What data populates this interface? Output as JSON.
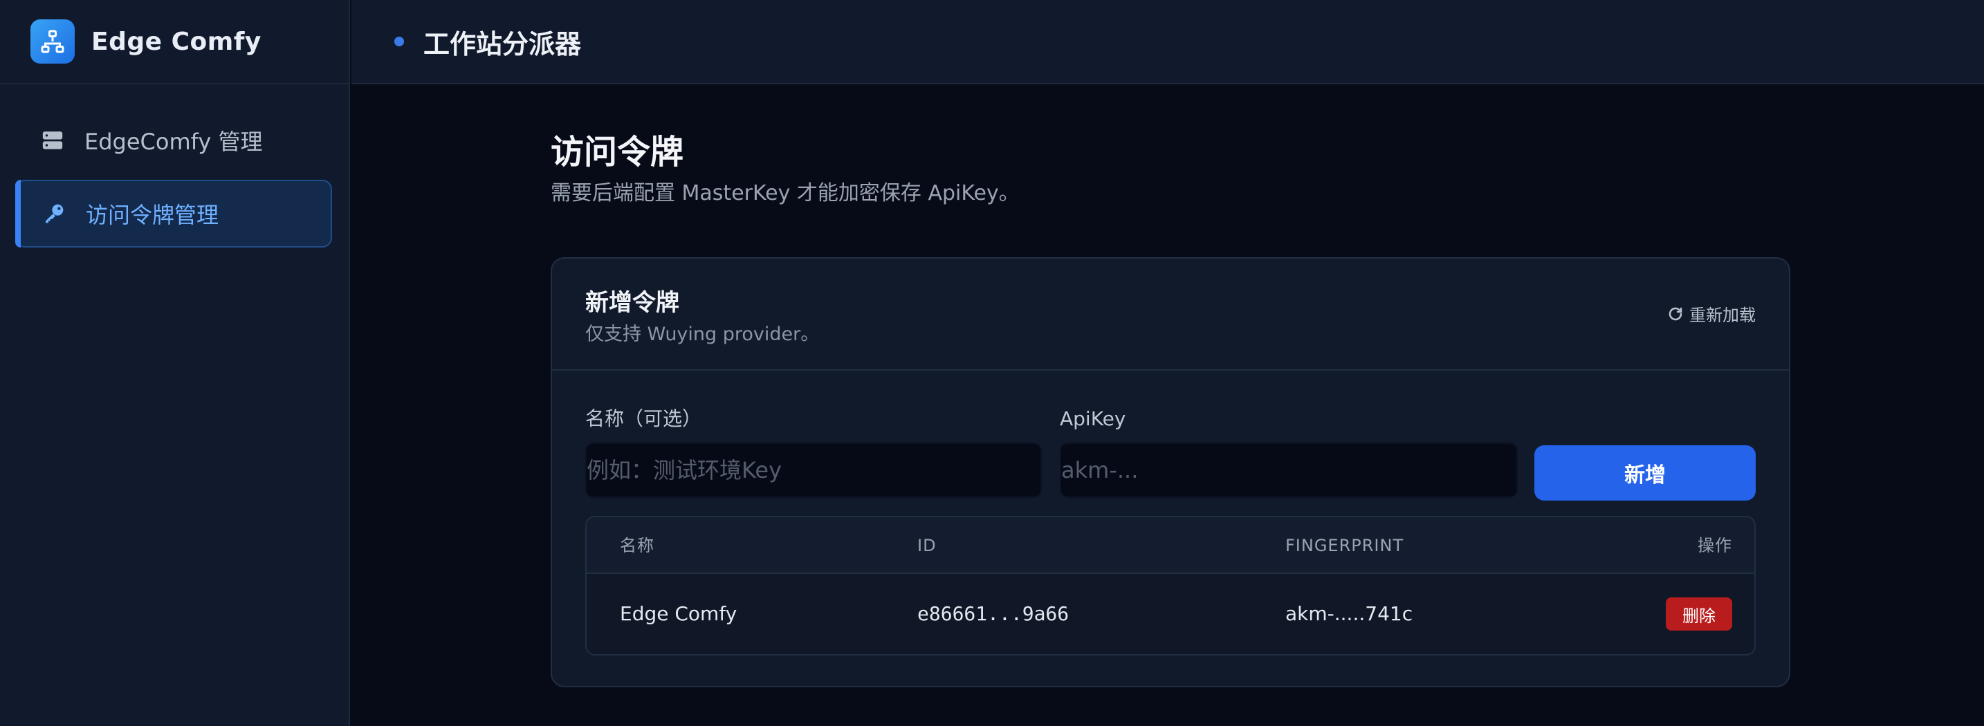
{
  "app": {
    "name": "Edge Comfy",
    "logo_icon": "network-icon",
    "accent_color": "#2563eb"
  },
  "header": {
    "title": "工作站分派器"
  },
  "sidebar": {
    "items": [
      {
        "label": "EdgeComfy 管理",
        "icon": "server-icon",
        "active": false
      },
      {
        "label": "访问令牌管理",
        "icon": "key-icon",
        "active": true
      }
    ]
  },
  "page": {
    "title": "访问令牌",
    "subtitle": "需要后端配置 MasterKey 才能加密保存 ApiKey。"
  },
  "card": {
    "title": "新增令牌",
    "subtitle": "仅支持 Wuying provider。",
    "reload_label": "重新加载",
    "form": {
      "name_label": "名称（可选）",
      "name_placeholder": "例如：测试环境Key",
      "name_value": "",
      "apikey_label": "ApiKey",
      "apikey_placeholder": "akm-...",
      "apikey_value": "",
      "add_label": "新增"
    },
    "table": {
      "columns": [
        "名称",
        "ID",
        "FINGERPRINT",
        "操作"
      ],
      "rows": [
        {
          "name": "Edge Comfy",
          "id": "e86661...9a66",
          "fingerprint": "akm-.....741c",
          "action_label": "删除"
        }
      ]
    }
  },
  "colors": {
    "danger": "#b91c1c",
    "primary": "#2563eb",
    "active_nav_text": "#6fb0ff"
  }
}
